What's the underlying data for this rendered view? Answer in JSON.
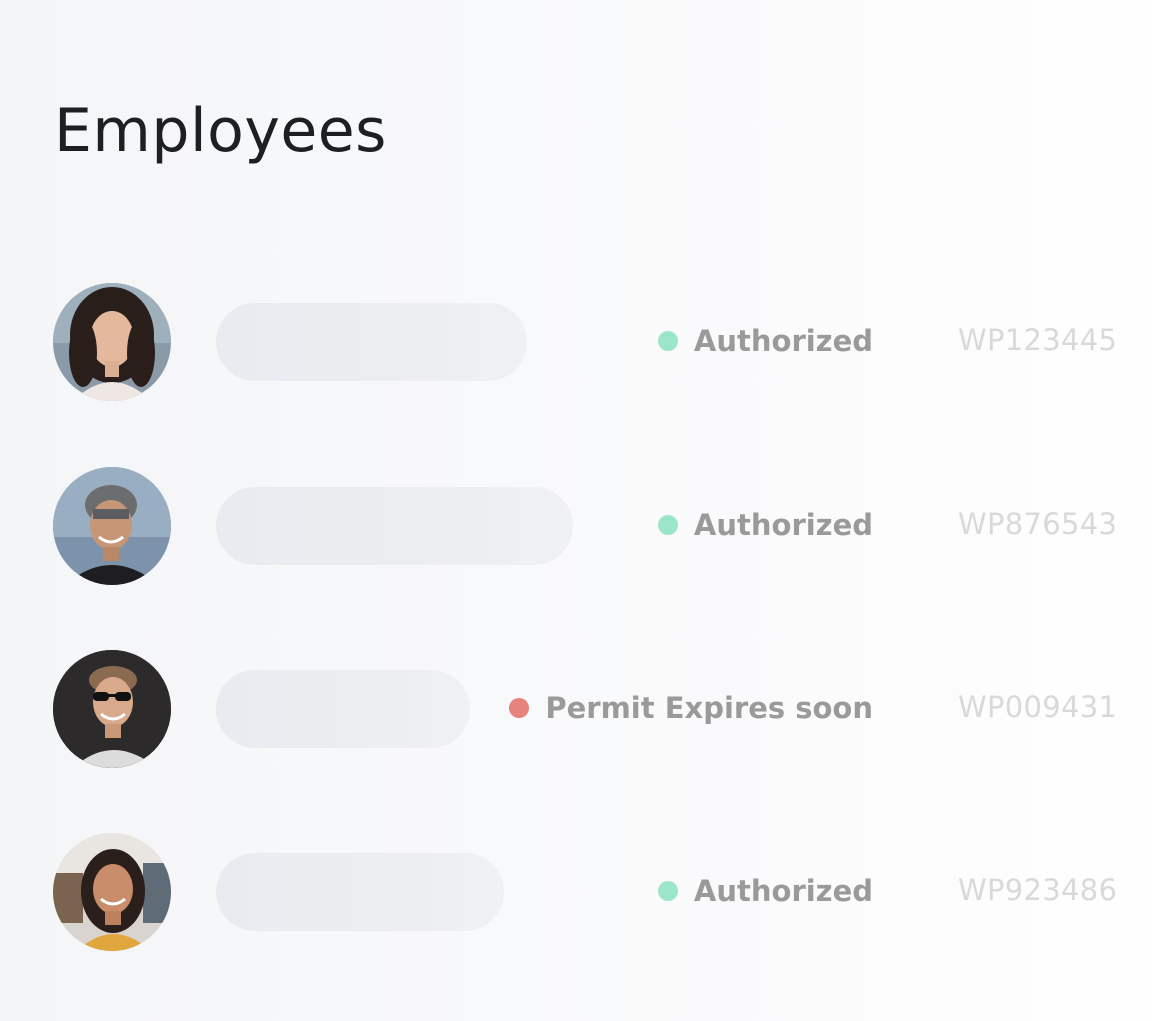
{
  "page": {
    "title": "Employees"
  },
  "colors": {
    "authorized": "#9be6c8",
    "expiring": "#e6837c"
  },
  "employees": [
    {
      "status": "Authorized",
      "status_kind": "authorized",
      "permit": "WP123445"
    },
    {
      "status": "Authorized",
      "status_kind": "authorized",
      "permit": "WP876543"
    },
    {
      "status": "Permit Expires soon",
      "status_kind": "expiring",
      "permit": "WP009431"
    },
    {
      "status": "Authorized",
      "status_kind": "authorized",
      "permit": "WP923486"
    }
  ]
}
